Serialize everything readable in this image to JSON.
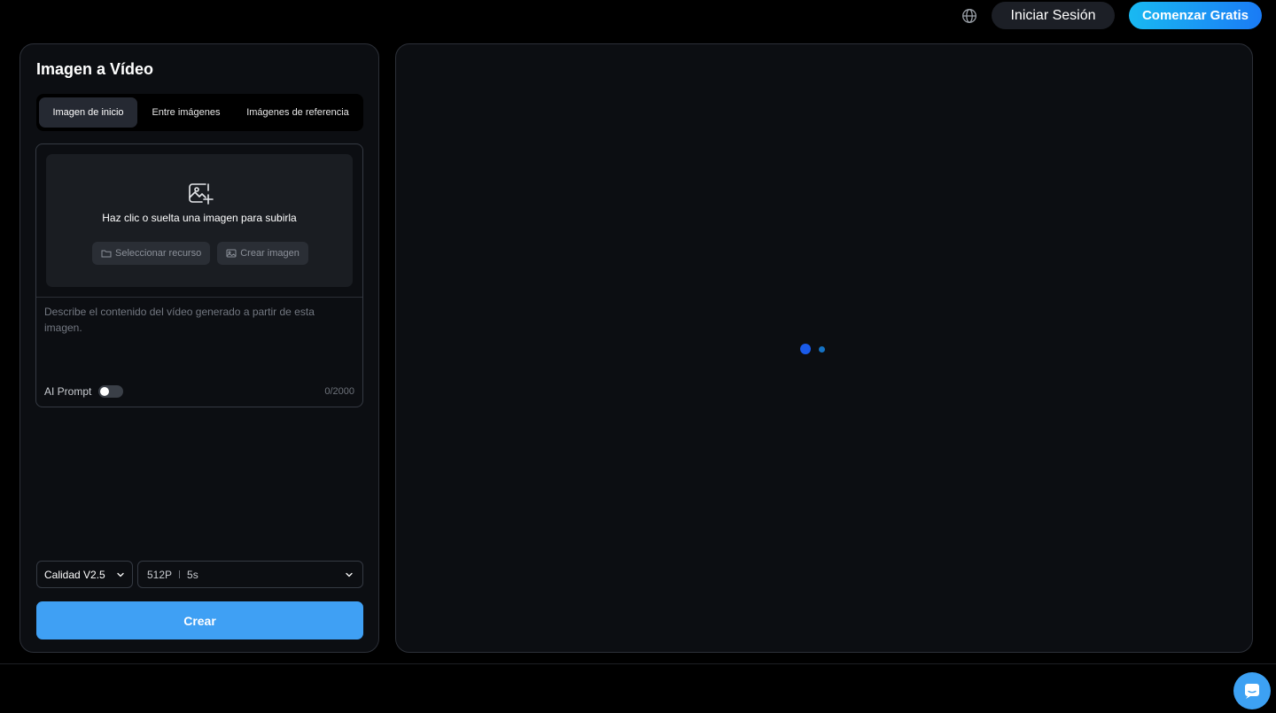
{
  "header": {
    "language_icon": "globe-icon",
    "signin_label": "Iniciar Sesión",
    "start_label": "Comenzar Gratis"
  },
  "left_panel": {
    "title": "Imagen a Vídeo",
    "tabs": [
      {
        "label": "Imagen de inicio",
        "active": true
      },
      {
        "label": "Entre imágenes",
        "active": false
      },
      {
        "label": "Imágenes de referencia",
        "active": false
      }
    ],
    "upload": {
      "icon": "image-add-icon",
      "text": "Haz clic o suelta una imagen para subirla",
      "select_resource_label": "Seleccionar recurso",
      "create_image_label": "Crear imagen"
    },
    "prompt": {
      "value": "",
      "placeholder": "Describe el contenido del vídeo generado a partir de esta imagen.",
      "ai_prompt_label": "AI Prompt",
      "ai_prompt_enabled": false,
      "char_count": "0/2000"
    },
    "quality_select": {
      "value": "Calidad V2.5"
    },
    "resolution_select": {
      "resolution": "512P",
      "duration": "5s"
    },
    "create_label": "Crear"
  },
  "colors": {
    "accent": "#3fa0f4",
    "gradient_start": "#19b9f2",
    "gradient_end": "#1a7bf5",
    "panel_bg": "#0c0e12",
    "page_bg": "#000000"
  },
  "chat": {
    "icon": "chat-icon"
  }
}
